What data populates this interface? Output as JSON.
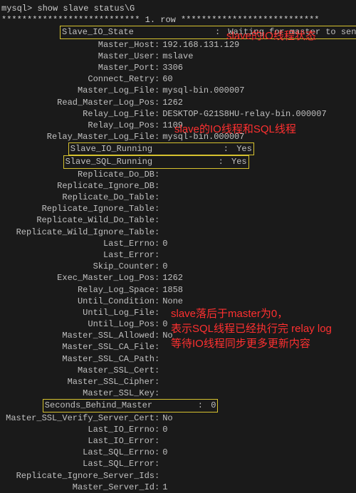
{
  "prompt": "mysql> show slave status\\G",
  "row_header": "*************************** 1. row ***************************",
  "rows": [
    {
      "k": "Slave_IO_State",
      "v": "Waiting for master to send event",
      "hl": "value_box"
    },
    {
      "k": "Master_Host",
      "v": "192.168.131.129"
    },
    {
      "k": "Master_User",
      "v": "mslave"
    },
    {
      "k": "Master_Port",
      "v": "3306"
    },
    {
      "k": "Connect_Retry",
      "v": "60"
    },
    {
      "k": "Master_Log_File",
      "v": "mysql-bin.000007"
    },
    {
      "k": "Read_Master_Log_Pos",
      "v": "1262"
    },
    {
      "k": "Relay_Log_File",
      "v": "DESKTOP-G21S8HU-relay-bin.000007"
    },
    {
      "k": "Relay_Log_Pos",
      "v": "1109"
    },
    {
      "k": "Relay_Master_Log_File",
      "v": "mysql-bin.000007"
    },
    {
      "k": "Slave_IO_Running",
      "v": "Yes",
      "hl": "key_box"
    },
    {
      "k": "Slave_SQL_Running",
      "v": "Yes",
      "hl": "key_box"
    },
    {
      "k": "Replicate_Do_DB",
      "v": ""
    },
    {
      "k": "Replicate_Ignore_DB",
      "v": ""
    },
    {
      "k": "Replicate_Do_Table",
      "v": ""
    },
    {
      "k": "Replicate_Ignore_Table",
      "v": ""
    },
    {
      "k": "Replicate_Wild_Do_Table",
      "v": ""
    },
    {
      "k": "Replicate_Wild_Ignore_Table",
      "v": ""
    },
    {
      "k": "Last_Errno",
      "v": "0"
    },
    {
      "k": "Last_Error",
      "v": ""
    },
    {
      "k": "Skip_Counter",
      "v": "0"
    },
    {
      "k": "Exec_Master_Log_Pos",
      "v": "1262"
    },
    {
      "k": "Relay_Log_Space",
      "v": "1858"
    },
    {
      "k": "Until_Condition",
      "v": "None"
    },
    {
      "k": "Until_Log_File",
      "v": ""
    },
    {
      "k": "Until_Log_Pos",
      "v": "0"
    },
    {
      "k": "Master_SSL_Allowed",
      "v": "No"
    },
    {
      "k": "Master_SSL_CA_File",
      "v": ""
    },
    {
      "k": "Master_SSL_CA_Path",
      "v": ""
    },
    {
      "k": "Master_SSL_Cert",
      "v": ""
    },
    {
      "k": "Master_SSL_Cipher",
      "v": ""
    },
    {
      "k": "Master_SSL_Key",
      "v": ""
    },
    {
      "k": "Seconds_Behind_Master",
      "v": "0",
      "hl": "key_box"
    },
    {
      "k": "Master_SSL_Verify_Server_Cert",
      "v": "No"
    },
    {
      "k": "Last_IO_Errno",
      "v": "0"
    },
    {
      "k": "Last_IO_Error",
      "v": ""
    },
    {
      "k": "Last_SQL_Errno",
      "v": "0"
    },
    {
      "k": "Last_SQL_Error",
      "v": ""
    },
    {
      "k": "Replicate_Ignore_Server_Ids",
      "v": ""
    },
    {
      "k": "Master_Server_Id",
      "v": "1"
    }
  ],
  "annotations": {
    "a1": "slave的IO线程状态",
    "a2": "slave的IO线程和SQL线程",
    "a3": "slave落后于master为0，\n表示SQL线程已经执行完 relay log\n等待IO线程同步更多更新内容"
  }
}
